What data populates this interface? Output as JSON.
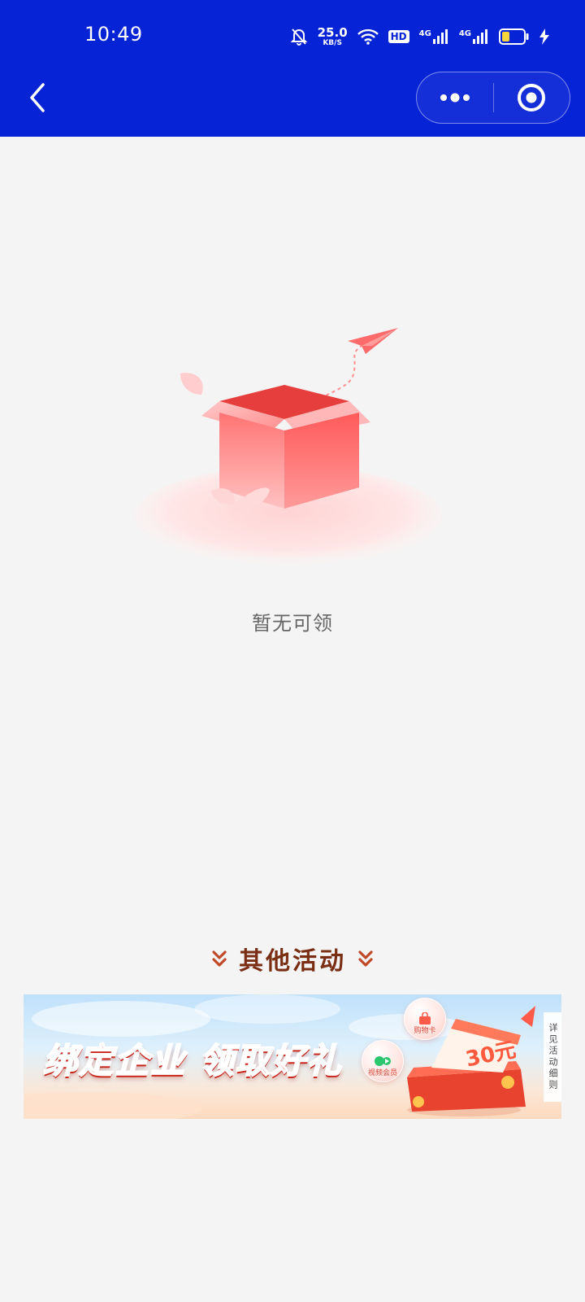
{
  "status_bar": {
    "time": "10:49",
    "net_speed_value": "25.0",
    "net_speed_unit": "KB/S",
    "hd_label": "HD",
    "signal_1_label": "4G",
    "signal_2_label": "4G",
    "icons": [
      "mute-bell-icon",
      "wifi-icon",
      "hd-icon",
      "signal-icon",
      "signal-icon",
      "battery-icon",
      "charging-icon"
    ]
  },
  "nav": {
    "back_icon": "chevron-left-icon",
    "more_icon": "more-dots-icon",
    "close_icon": "target-icon"
  },
  "empty_state": {
    "illustration": "empty-box-illustration",
    "message": "暂无可领"
  },
  "other_activities": {
    "title": "其他活动",
    "banner": {
      "headline": "绑定企业 领取好礼",
      "bubble_shopping": "购物卡",
      "bubble_video": "视频会员",
      "coupon_value": "30元",
      "side_tag": "详见活动细则"
    }
  },
  "colors": {
    "nav_bg": "#0623d6",
    "page_bg": "#f4f4f4",
    "section_title": "#7a2e13",
    "banner_accent": "#ff4a3a"
  }
}
